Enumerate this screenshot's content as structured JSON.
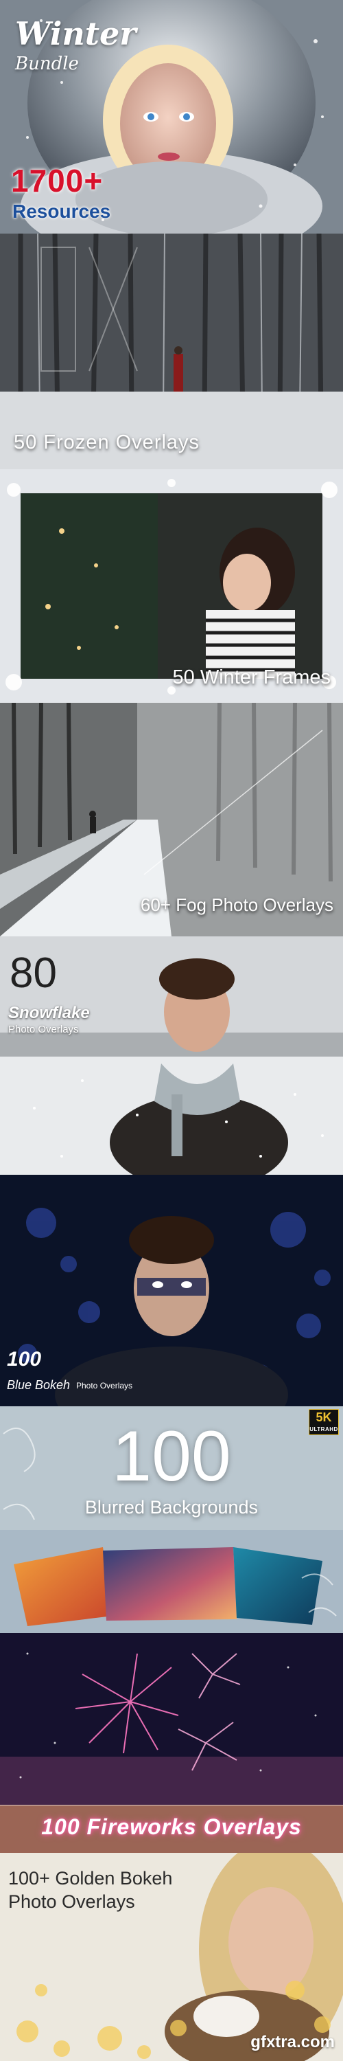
{
  "panels": {
    "winter_bundle": {
      "title": "Winter",
      "subtitle": "Bundle",
      "count": "1700+",
      "count_label": "Resources"
    },
    "frozen_overlays": {
      "caption": "50 Frozen Overlays"
    },
    "winter_frames": {
      "caption": "50 Winter Frames"
    },
    "fog_overlays": {
      "caption": "60+ Fog Photo Overlays"
    },
    "snowflake_overlays": {
      "number": "80",
      "name": "Snowflake",
      "label": "Photo Overlays"
    },
    "blue_bokeh": {
      "number": "100",
      "name": "Blue Bokeh",
      "label": "Photo Overlays"
    },
    "blurred_backgrounds": {
      "number": "100",
      "label": "Blurred Backgrounds",
      "badge_top": "5K",
      "badge_bottom": "ULTRAHD"
    },
    "fireworks_overlays": {
      "caption": "100 Fireworks Overlays"
    },
    "golden_bokeh": {
      "line1": "100+ Golden Bokeh",
      "line2": "Photo Overlays"
    }
  },
  "watermark": "gfxtra.com",
  "colors": {
    "count_red": "#d8112b",
    "resources_blue": "#1c4f9c",
    "fireworks_glow": "#ff5ca8",
    "badge_gold": "#f1c232"
  }
}
